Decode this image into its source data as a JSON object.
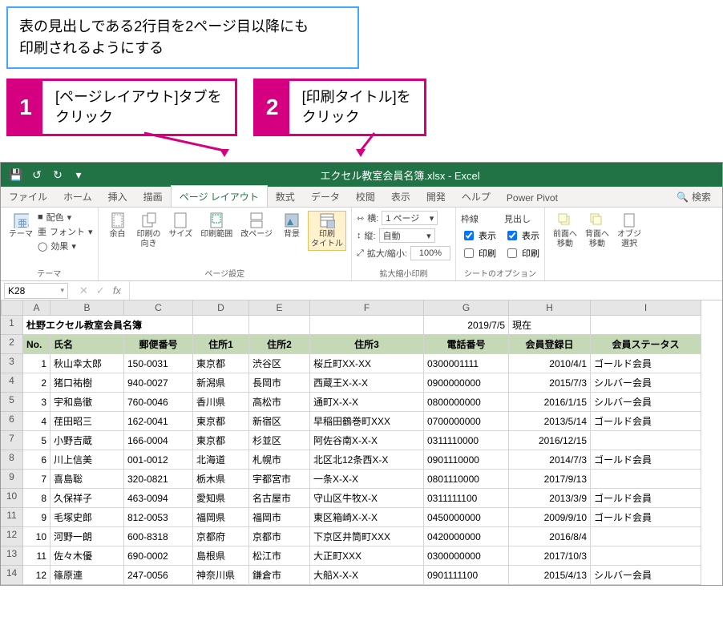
{
  "instruction": "表の見出しである2行目を2ページ目以降にも\n印刷されるようにする",
  "steps": [
    {
      "num": "1",
      "text": "[ページレイアウト]タブを\nクリック"
    },
    {
      "num": "2",
      "text": "[印刷タイトル]を\nクリック"
    }
  ],
  "app": {
    "title_doc": "エクセル教室会員名簿.xlsx - Excel",
    "tabs": [
      "ファイル",
      "ホーム",
      "挿入",
      "描画",
      "ページ レイアウト",
      "数式",
      "データ",
      "校閲",
      "表示",
      "開発",
      "ヘルプ",
      "Power Pivot"
    ],
    "search_label": "検索",
    "namebox": "K28",
    "ribbon": {
      "themes_label": "テーマ",
      "themes_items": {
        "theme": "テーマ",
        "colors": "配色",
        "fonts": "フォント",
        "effects": "効果"
      },
      "page_setup_label": "ページ設定",
      "page_setup_items": {
        "margins": "余白",
        "orientation": "印刷の\n向き",
        "size": "サイズ",
        "print_area": "印刷範囲",
        "breaks": "改ページ",
        "background": "背景",
        "print_titles": "印刷\nタイトル"
      },
      "scale_label": "拡大縮小印刷",
      "scale_items": {
        "width": "横:",
        "height": "縦:",
        "scale": "拡大/縮小:",
        "width_val": "1 ページ",
        "height_val": "自動",
        "scale_val": "100%"
      },
      "sheet_options_label": "シートのオプション",
      "sheet_options": {
        "gridlines": "枠線",
        "headings": "見出し",
        "view": "表示",
        "print": "印刷"
      },
      "arrange": {
        "front": "前面へ\n移動",
        "back": "背面へ\n移動",
        "select": "オブジ\n選択"
      }
    }
  },
  "sheet": {
    "columns": [
      "A",
      "B",
      "C",
      "D",
      "E",
      "F",
      "G",
      "H",
      "I"
    ],
    "title": "杜野エクセル教室会員名簿",
    "title_date": "2019/7/5",
    "title_status_label": "現在",
    "headers": [
      "No.",
      "氏名",
      "郵便番号",
      "住所1",
      "住所2",
      "住所3",
      "電話番号",
      "会員登録日",
      "会員ステータス"
    ],
    "rows": [
      {
        "n": "1",
        "name": "秋山幸太郎",
        "zip": "150-0031",
        "a1": "東京都",
        "a2": "渋谷区",
        "a3": "桜丘町XX-XX",
        "tel": "0300001111",
        "date": "2010/4/1",
        "status": "ゴールド会員"
      },
      {
        "n": "2",
        "name": "猪口祐樹",
        "zip": "940-0027",
        "a1": "新潟県",
        "a2": "長岡市",
        "a3": "西蔵王X-X-X",
        "tel": "0900000000",
        "date": "2015/7/3",
        "status": "シルバー会員"
      },
      {
        "n": "3",
        "name": "宇和島徹",
        "zip": "760-0046",
        "a1": "香川県",
        "a2": "高松市",
        "a3": "通町X-X-X",
        "tel": "0800000000",
        "date": "2016/1/15",
        "status": "シルバー会員"
      },
      {
        "n": "4",
        "name": "荏田昭三",
        "zip": "162-0041",
        "a1": "東京都",
        "a2": "新宿区",
        "a3": "早稲田鶴巻町XXX",
        "tel": "0700000000",
        "date": "2013/5/14",
        "status": "ゴールド会員"
      },
      {
        "n": "5",
        "name": "小野吉蔵",
        "zip": "166-0004",
        "a1": "東京都",
        "a2": "杉並区",
        "a3": "阿佐谷南X-X-X",
        "tel": "0311110000",
        "date": "2016/12/15",
        "status": ""
      },
      {
        "n": "6",
        "name": "川上信美",
        "zip": "001-0012",
        "a1": "北海道",
        "a2": "札幌市",
        "a3": "北区北12条西X-X",
        "tel": "0901110000",
        "date": "2014/7/3",
        "status": "ゴールド会員"
      },
      {
        "n": "7",
        "name": "喜島聡",
        "zip": "320-0821",
        "a1": "栃木県",
        "a2": "宇都宮市",
        "a3": "一条X-X-X",
        "tel": "0801110000",
        "date": "2017/9/13",
        "status": ""
      },
      {
        "n": "8",
        "name": "久保祥子",
        "zip": "463-0094",
        "a1": "愛知県",
        "a2": "名古屋市",
        "a3": "守山区牛牧X-X",
        "tel": "0311111100",
        "date": "2013/3/9",
        "status": "ゴールド会員"
      },
      {
        "n": "9",
        "name": "毛塚史郎",
        "zip": "812-0053",
        "a1": "福岡県",
        "a2": "福岡市",
        "a3": "東区箱崎X-X-X",
        "tel": "0450000000",
        "date": "2009/9/10",
        "status": "ゴールド会員"
      },
      {
        "n": "10",
        "name": "河野一朗",
        "zip": "600-8318",
        "a1": "京都府",
        "a2": "京都市",
        "a3": "下京区井筒町XXX",
        "tel": "0420000000",
        "date": "2016/8/4",
        "status": ""
      },
      {
        "n": "11",
        "name": "佐々木優",
        "zip": "690-0002",
        "a1": "島根県",
        "a2": "松江市",
        "a3": "大正町XXX",
        "tel": "0300000000",
        "date": "2017/10/3",
        "status": ""
      },
      {
        "n": "12",
        "name": "篠原連",
        "zip": "247-0056",
        "a1": "神奈川県",
        "a2": "鎌倉市",
        "a3": "大船X-X-X",
        "tel": "0901111100",
        "date": "2015/4/13",
        "status": "シルバー会員"
      }
    ]
  }
}
